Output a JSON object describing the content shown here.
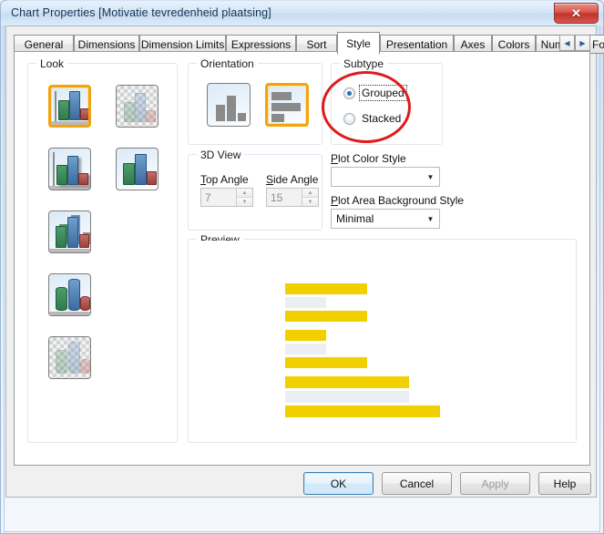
{
  "window": {
    "title": "Chart Properties [Motivatie tevredenheid plaatsing]",
    "close_label": "✕",
    "close_icon": "close-icon"
  },
  "tabs": [
    {
      "label": "General",
      "selected": false
    },
    {
      "label": "Dimensions",
      "selected": false
    },
    {
      "label": "Dimension Limits",
      "selected": false
    },
    {
      "label": "Expressions",
      "selected": false
    },
    {
      "label": "Sort",
      "selected": false
    },
    {
      "label": "Style",
      "selected": true
    },
    {
      "label": "Presentation",
      "selected": false
    },
    {
      "label": "Axes",
      "selected": false
    },
    {
      "label": "Colors",
      "selected": false
    },
    {
      "label": "Number",
      "selected": false
    },
    {
      "label": "Font",
      "selected": false
    }
  ],
  "tab_nav": {
    "prev": "◀",
    "next": "▶"
  },
  "look": {
    "legend": "Look",
    "items": [
      {
        "name": "look-flat-2d-solid",
        "selected": true,
        "variant": "flat"
      },
      {
        "name": "look-flat-2d-transparent",
        "selected": false,
        "variant": "checker"
      },
      {
        "name": "look-2d-shadow",
        "selected": false,
        "variant": "shadow"
      },
      {
        "name": "look-2d-plain",
        "selected": false,
        "variant": "plain"
      },
      {
        "name": "look-3d-bars",
        "selected": false,
        "variant": "bars3d"
      },
      {
        "name": "look-3d-cylinders",
        "selected": false,
        "variant": "cyl3d"
      },
      {
        "name": "look-3d-transparent",
        "selected": false,
        "variant": "checker3d"
      }
    ]
  },
  "orientation": {
    "legend": "Orientation",
    "items": [
      {
        "name": "orientation-vertical",
        "selected": false
      },
      {
        "name": "orientation-horizontal",
        "selected": true
      }
    ]
  },
  "view3d": {
    "legend": "3D View",
    "top_angle_label": "Top Angle",
    "top_angle_accel": "T",
    "top_angle_value": "7",
    "side_angle_label": "Side Angle",
    "side_angle_accel": "S",
    "side_angle_value": "15",
    "enabled": false,
    "up_arrow": "▲",
    "down_arrow": "▼"
  },
  "subtype": {
    "legend": "Subtype",
    "options": [
      {
        "label": "Grouped",
        "selected": true,
        "focused": true
      },
      {
        "label": "Stacked",
        "selected": false,
        "focused": false
      }
    ]
  },
  "plot_color_style": {
    "label": "Plot Color Style",
    "accel": "P",
    "value": "",
    "arrow": "▼"
  },
  "plot_area_background_style": {
    "label": "Plot Area Background Style",
    "accel": "P",
    "value": "Minimal",
    "arrow": "▼"
  },
  "preview": {
    "legend": "Preview",
    "bar_color": "#f2d000",
    "alt_bar_color": "#eceff1",
    "bars": [
      {
        "group": 1,
        "series": 1,
        "length": 90,
        "color": "#f2d000"
      },
      {
        "group": 1,
        "series": 2,
        "length": 45,
        "color": "#eceff1"
      },
      {
        "group": 1,
        "series": 3,
        "length": 90,
        "color": "#f2d000"
      },
      {
        "group": 2,
        "series": 1,
        "length": 45,
        "color": "#f2d000"
      },
      {
        "group": 2,
        "series": 2,
        "length": 45,
        "color": "#eceff1"
      },
      {
        "group": 2,
        "series": 3,
        "length": 90,
        "color": "#f2d000"
      },
      {
        "group": 3,
        "series": 1,
        "length": 136,
        "color": "#f2d000"
      },
      {
        "group": 3,
        "series": 2,
        "length": 136,
        "color": "#eceff1"
      },
      {
        "group": 3,
        "series": 3,
        "length": 170,
        "color": "#f2d000"
      }
    ]
  },
  "annotation": {
    "shape": "ellipse",
    "color": "#e01b1b",
    "target": "subtype-radio-group"
  },
  "buttons": [
    {
      "label": "OK",
      "name": "ok-button",
      "style": "default",
      "disabled": false
    },
    {
      "label": "Cancel",
      "name": "cancel-button",
      "style": "normal",
      "disabled": false
    },
    {
      "label": "Apply",
      "name": "apply-button",
      "style": "normal",
      "disabled": true
    },
    {
      "label": "Help",
      "name": "help-button",
      "style": "normal",
      "disabled": false
    }
  ]
}
